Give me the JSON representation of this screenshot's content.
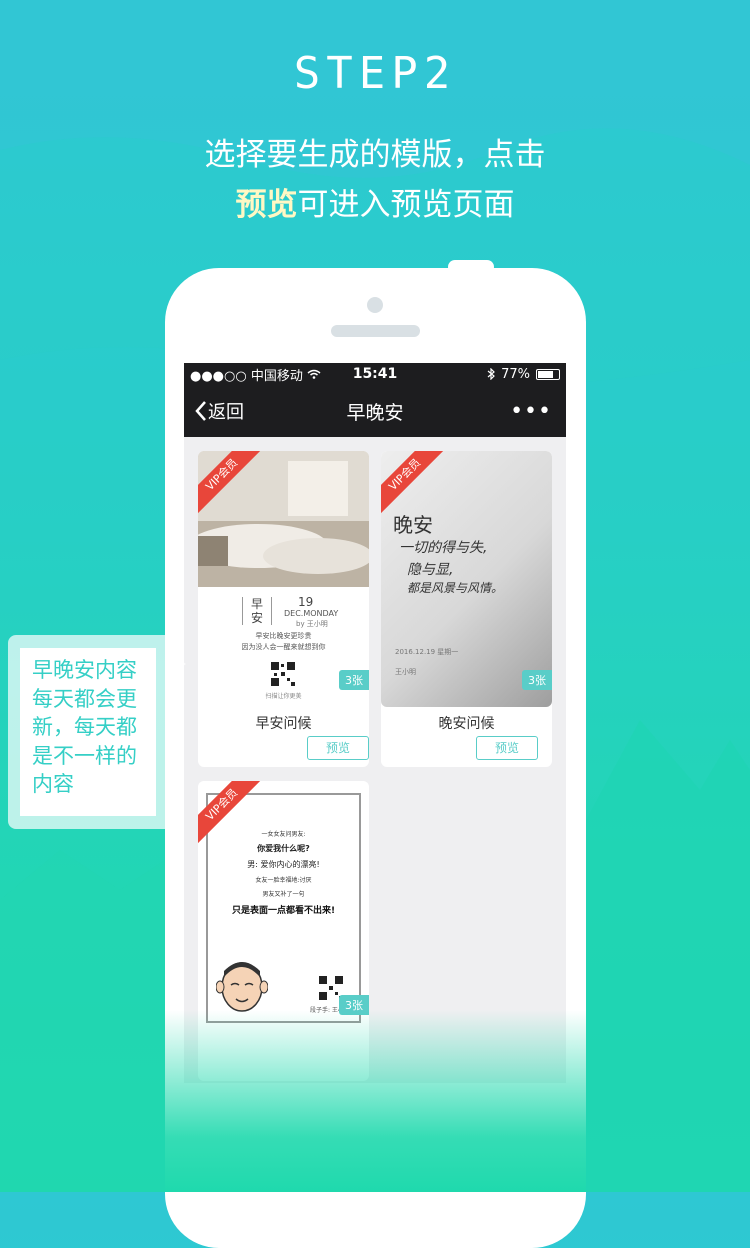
{
  "step": {
    "title": "STEP2"
  },
  "intro": {
    "line1": "选择要生成的模版，点击",
    "highlight": "预览",
    "line2_rest": "可进入预览页面"
  },
  "status_bar": {
    "carrier": "●●●○○ 中国移动",
    "time": "15:41",
    "battery": "77%"
  },
  "nav": {
    "back_label": "返回",
    "title": "早晚安",
    "more": "•••"
  },
  "cards": [
    {
      "ribbon": "VIP会员",
      "count": "3张",
      "title": "早安问候",
      "preview_label": "预览",
      "thumb": {
        "logo_top": "早",
        "logo_bottom": "安",
        "day": "19",
        "date_line": "DEC.MONDAY",
        "author": "by 王小明",
        "line1": "早安比晚安更珍贵",
        "line2": "因为没人会一醒来就想到你",
        "scan_text": "扫描让你更美"
      }
    },
    {
      "ribbon": "VIP会员",
      "count": "3张",
      "title": "晚安问候",
      "preview_label": "预览",
      "thumb": {
        "heading": "晚安",
        "line1": "一切的得与失,",
        "line2": "隐与显,",
        "line3": "都是风景与风情。",
        "date": "2016.12.19 星期一",
        "author": "王小明"
      }
    },
    {
      "ribbon": "VIP会员",
      "count": "3张",
      "thumb": {
        "l1": "一女女友问男友:",
        "l2": "你爱我什么呢?",
        "l3": "男: 爱你内心的漂亮!",
        "l4": "女友一脸幸福地:讨厌",
        "l5": "男友又补了一句",
        "l6": "只是表面一点都看不出来!",
        "sign": "段子手: 王小明"
      }
    }
  ],
  "callout": {
    "text": "早晚安内容每天都会更新，每天都是不一样的内容"
  },
  "colors": {
    "accent": "#59cdc8",
    "ribbon": "#e8463a",
    "bg_top": "#2ec8d3",
    "bg_bottom": "#1fd9ad",
    "highlight": "#fff8c4"
  }
}
